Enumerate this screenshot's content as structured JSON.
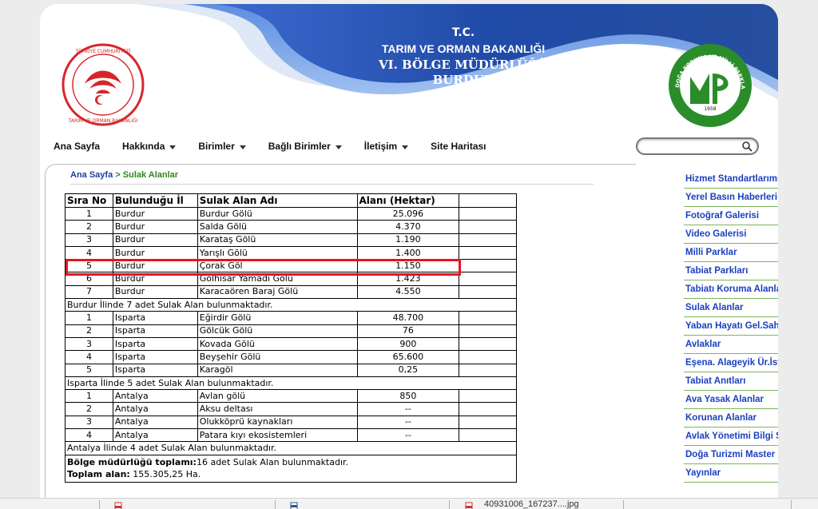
{
  "header": {
    "line1": "T.C.",
    "line2": "TARIM VE ORMAN BAKANLIĞI",
    "line3": "VI. BÖLGE MÜDÜRLÜĞÜ",
    "line4": "BURDUR",
    "left_logo_icon": "ministry-emblem-icon",
    "right_logo_icon": "doga-koruma-milli-parklar-logo-icon",
    "right_logo_text": "DOĞA KORUMA VE MİLLİ PARKLAR GENEL MÜDÜRLÜĞÜ",
    "right_logo_year": "1958",
    "left_logo_text": "TÜRKİYE CUMHURİYETİ TARIM VE ORMAN BAKANLIĞI"
  },
  "nav": {
    "items": [
      {
        "label": "Ana Sayfa",
        "dropdown": false
      },
      {
        "label": "Hakkında",
        "dropdown": true
      },
      {
        "label": "Birimler",
        "dropdown": true
      },
      {
        "label": "Bağlı Birimler",
        "dropdown": true
      },
      {
        "label": "İletişim",
        "dropdown": true
      },
      {
        "label": "Site Haritası",
        "dropdown": false
      }
    ],
    "search_icon": "search-icon"
  },
  "breadcrumb": {
    "home": "Ana Sayfa",
    "separator": ">",
    "current": "Sulak Alanlar"
  },
  "table": {
    "headers": [
      "Sıra No",
      "Bulunduğu İl",
      "Sulak Alan Adı",
      "Alanı (Hektar)",
      ""
    ],
    "rows": [
      {
        "type": "data",
        "no": "1",
        "il": "Burdur",
        "ad": "Burdur Gölü",
        "alan": "25.096"
      },
      {
        "type": "data",
        "no": "2",
        "il": "Burdur",
        "ad": "Salda Gölü",
        "alan": "4.370"
      },
      {
        "type": "data",
        "no": "3",
        "il": "Burdur",
        "ad": "Karataş Gölü",
        "alan": "1.190"
      },
      {
        "type": "data",
        "no": "4",
        "il": "Burdur",
        "ad": "Yarışlı Gölü",
        "alan": "1.400"
      },
      {
        "type": "data",
        "no": "5",
        "il": "Burdur",
        "ad": "Çorak Göl",
        "alan": "1.150"
      },
      {
        "type": "data",
        "no": "6",
        "il": "Burdur",
        "ad": "Gölhisar Yamadı Gölü",
        "alan": "1.423"
      },
      {
        "type": "data",
        "no": "7",
        "il": "Burdur",
        "ad": "Karacaören Baraj Gölü",
        "alan": "4.550"
      },
      {
        "type": "summary",
        "text": "Burdur İlinde 7 adet Sulak Alan bulunmaktadır."
      },
      {
        "type": "data",
        "no": "1",
        "il": "Isparta",
        "ad": "Eğirdir Gölü",
        "alan": "48.700"
      },
      {
        "type": "data",
        "no": "2",
        "il": "Isparta",
        "ad": "Gölcük Gölü",
        "alan": "76"
      },
      {
        "type": "data",
        "no": "3",
        "il": "Isparta",
        "ad": "Kovada Gölü",
        "alan": "900"
      },
      {
        "type": "data",
        "no": "4",
        "il": "Isparta",
        "ad": "Beyşehir Gölü",
        "alan": "65.600"
      },
      {
        "type": "data",
        "no": "5",
        "il": "Isparta",
        "ad": "Karagöl",
        "alan": "0,25"
      },
      {
        "type": "summary",
        "text": "Isparta İlinde 5 adet Sulak Alan bulunmaktadır."
      },
      {
        "type": "data",
        "no": "1",
        "il": "Antalya",
        "ad": "Avlan gölü",
        "alan": "850"
      },
      {
        "type": "data",
        "no": "2",
        "il": "Antalya",
        "ad": "Aksu deltası",
        "alan": "--"
      },
      {
        "type": "data",
        "no": "3",
        "il": "Antalya",
        "ad": "Olukköprü kaynakları",
        "alan": "--"
      },
      {
        "type": "data",
        "no": "4",
        "il": "Antalya",
        "ad": "Patara kıyı ekosistemleri",
        "alan": "--"
      },
      {
        "type": "summary",
        "text": "Antalya İlinde 4 adet Sulak Alan bulunmaktadır."
      }
    ],
    "total_region_label": "Bölge müdürlüğü toplamı:",
    "total_region_value": "16 adet Sulak Alan bulunmaktadır.",
    "total_area_label": "Toplam alan:",
    "total_area_value": " 155.305,25 Ha.",
    "highlighted_row": "Çorak Göl"
  },
  "sidebar": {
    "links": [
      "Hizmet Standartlarımız",
      "Yerel Basın Haberleri",
      "Fotoğraf Galerisi",
      "Video Galerisi",
      "Milli Parklar",
      "Tabiat Parkları",
      "Tabiatı Koruma Alanları",
      "Sulak Alanlar",
      "Yaban Hayatı Gel.Saha.",
      "Avlaklar",
      "Eşena. Alageyik Ür.İst.",
      "Tabiat Anıtları",
      "Ava Yasak Alanlar",
      "Korunan Alanlar",
      "Avlak Yönetimi Bilgi Sistemi",
      "Doğa Turizmi Master Planları",
      "Yayınlar"
    ]
  },
  "taskbar": {
    "file_label": "40931006_167237....jpg"
  },
  "colors": {
    "header_blue": "#1f4aa6",
    "link_blue": "#1a3fbf",
    "breadcrumb_green": "#2a8a1a",
    "highlight_red": "#e8141c",
    "sidebar_divider": "#7bb65c"
  }
}
